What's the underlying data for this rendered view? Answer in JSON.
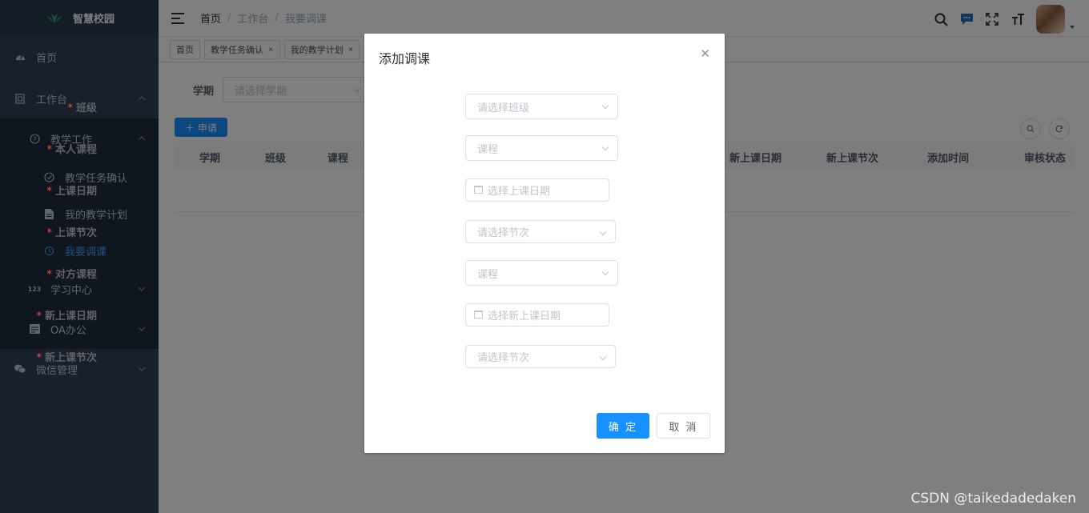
{
  "app": {
    "title": "智慧校园"
  },
  "sidebar": {
    "items": [
      {
        "label": "首页",
        "icon": "dashboard-icon"
      },
      {
        "label": "工作台",
        "icon": "monitor-icon"
      },
      {
        "label": "教学工作",
        "icon": "question-circle-icon"
      },
      {
        "label": "教学任务确认",
        "icon": "check-circle-icon"
      },
      {
        "label": "我的教学计划",
        "icon": "document-icon"
      },
      {
        "label": "我要调课",
        "icon": "swap-icon"
      },
      {
        "label": "学习中心",
        "icon": "number-icon"
      },
      {
        "label": "OA办公",
        "icon": "form-icon"
      },
      {
        "label": "微信管理",
        "icon": "wechat-icon"
      }
    ]
  },
  "breadcrumb": [
    "首页",
    "工作台",
    "我要调课"
  ],
  "tags": [
    "首页",
    "教学任务确认",
    "我的教学计划"
  ],
  "filter": {
    "label": "学期",
    "placeholder": "请选择学期"
  },
  "toolbar": {
    "add_label": "申请"
  },
  "table": {
    "columns": [
      "学期",
      "班级",
      "课程",
      "新上课日期",
      "新上课节次",
      "添加时间",
      "审核状态"
    ]
  },
  "dialog": {
    "title": "添加调课",
    "fields": [
      {
        "label": "班级",
        "placeholder": "请选择班级",
        "type": "select"
      },
      {
        "label": "本人课程",
        "placeholder": "课程",
        "type": "select"
      },
      {
        "label": "上课日期",
        "placeholder": "选择上课日期",
        "type": "date"
      },
      {
        "label": "上课节次",
        "placeholder": "请选择节次",
        "type": "select"
      },
      {
        "label": "对方课程",
        "placeholder": "课程",
        "type": "select"
      },
      {
        "label": "新上课日期",
        "placeholder": "选择新上课日期",
        "type": "date"
      },
      {
        "label": "新上课节次",
        "placeholder": "请选择节次",
        "type": "select"
      }
    ],
    "required_mark": "*",
    "confirm_label": "确 定",
    "cancel_label": "取 消"
  },
  "watermark": "CSDN @taikedadedaken",
  "colors": {
    "primary": "#1890ff",
    "sidebar": "#304156",
    "active": "#409eff",
    "required": "#ff4949"
  }
}
